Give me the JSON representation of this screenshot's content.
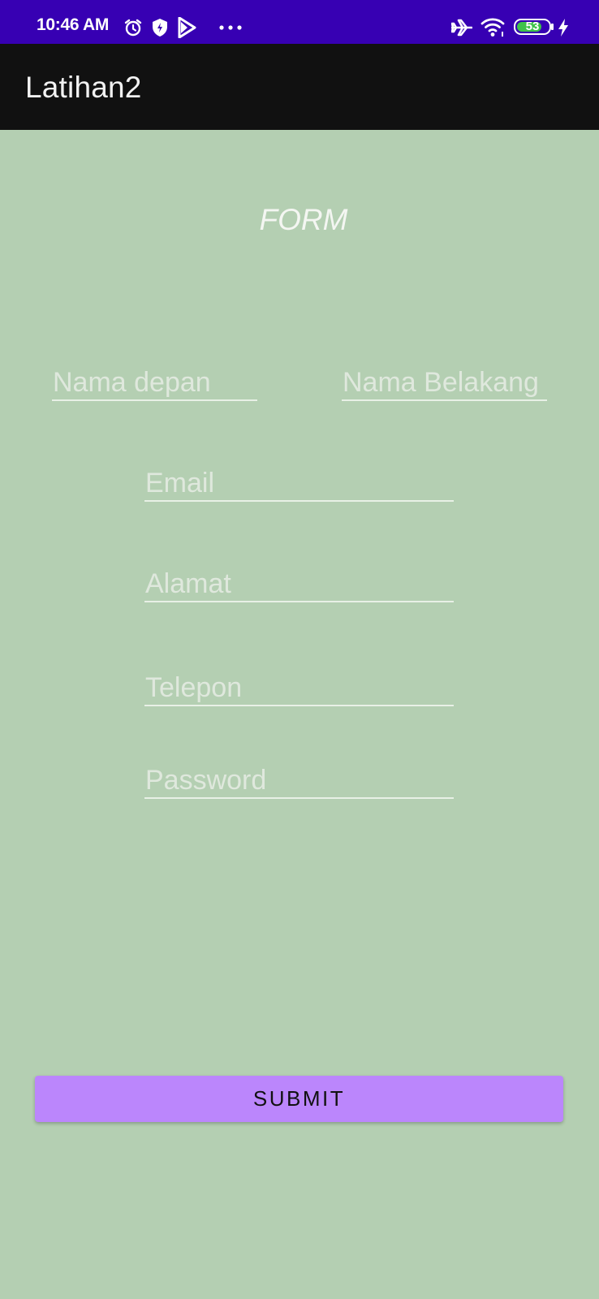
{
  "status_bar": {
    "time": "10:46 AM",
    "left_icons": [
      "alarm-icon",
      "shield-icon",
      "play-store-icon",
      "more-dots-icon"
    ],
    "right_icons": [
      "airplane-icon",
      "wifi-icon",
      "battery-icon",
      "charging-icon"
    ],
    "battery_level": "53",
    "background_color": "#3700b3"
  },
  "app_bar": {
    "title": "Latihan2",
    "background_color": "#111111"
  },
  "form": {
    "heading": "FORM",
    "background_color": "#b4cfb2",
    "fields": {
      "first_name": {
        "placeholder": "Nama depan",
        "value": ""
      },
      "last_name": {
        "placeholder": "Nama Belakang",
        "value": ""
      },
      "email": {
        "placeholder": "Email",
        "value": ""
      },
      "address": {
        "placeholder": "Alamat",
        "value": ""
      },
      "phone": {
        "placeholder": "Telepon",
        "value": ""
      },
      "password": {
        "placeholder": "Password",
        "value": ""
      }
    },
    "submit_label": "SUBMIT",
    "submit_color": "#bb86fc"
  }
}
